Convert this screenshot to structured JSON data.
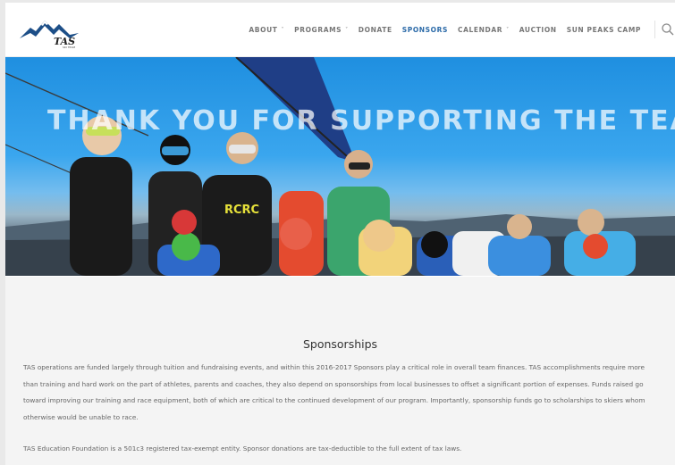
{
  "logo": {
    "text": "TAS",
    "sub": "SKI TEAM"
  },
  "nav": {
    "items": [
      {
        "label": "ABOUT",
        "dropdown": true
      },
      {
        "label": "PROGRAMS",
        "dropdown": true
      },
      {
        "label": "DONATE",
        "dropdown": false
      },
      {
        "label": "SPONSORS",
        "dropdown": false,
        "active": true
      },
      {
        "label": "CALENDAR",
        "dropdown": true
      },
      {
        "label": "AUCTION",
        "dropdown": false
      },
      {
        "label": "SUN PEAKS CAMP",
        "dropdown": false
      }
    ]
  },
  "hero": {
    "title": "THANK YOU FOR SUPPORTING THE TEAM",
    "shirt_text": "RCRC"
  },
  "main": {
    "heading": "Sponsorships",
    "paragraph1": "TAS operations are funded largely through tuition and fundraising events, and within this 2016-2017 Sponsors play a critical role in overall team finances. TAS accomplishments require more than training and hard work on the part of athletes, parents and coaches, they also depend on sponsorships from local businesses to offset a significant portion of expenses.  Funds raised go toward improving our training and race equipment, both of which are critical to the continued development of our program.  Importantly, sponsorship funds go to scholarships to skiers whom otherwise would be unable to race.",
    "paragraph2": "TAS Education Foundation is a 501c3 registered tax-exempt entity. Sponsor donations are tax-deductible to the full extent of tax laws."
  },
  "colors": {
    "accent": "#2b6aa8",
    "nav_text": "#777777",
    "content_bg": "#f4f4f4"
  }
}
